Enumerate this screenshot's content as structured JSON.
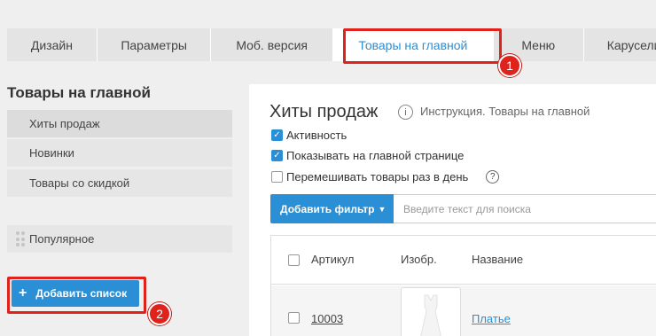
{
  "tabs": {
    "design": "Дизайн",
    "params": "Параметры",
    "mobile": "Моб. версия",
    "products": "Товары на главной",
    "menu": "Меню",
    "carousel": "Карусели"
  },
  "badges": {
    "one": "1",
    "two": "2"
  },
  "sidebar": {
    "title": "Товары на главной",
    "items": [
      "Хиты продаж",
      "Новинки",
      "Товары со скидкой",
      "Популярное"
    ],
    "add_button": "Добавить список",
    "add_icon": "+"
  },
  "main": {
    "title": "Хиты продаж",
    "instruction": "Инструкция. Товары на главной",
    "checkboxes": {
      "active": "Активность",
      "show_home": "Показывать на главной странице",
      "shuffle": "Перемешивать товары раз в день"
    },
    "filter_button": "Добавить фильтр",
    "search_placeholder": "Введите текст для поиска",
    "columns": {
      "sku": "Артикул",
      "image": "Изобр.",
      "name": "Название"
    },
    "rows": [
      {
        "sku": "10003",
        "name": "Платье"
      }
    ]
  },
  "colors": {
    "accent": "#2b8fd6",
    "highlight": "#e0221c"
  }
}
